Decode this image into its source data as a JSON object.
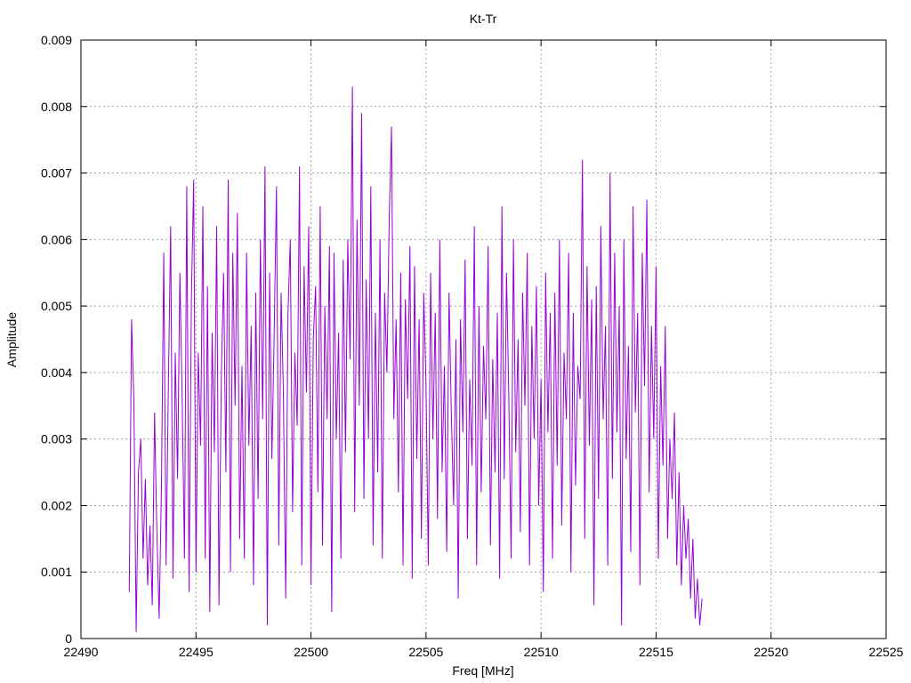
{
  "chart_data": {
    "type": "line",
    "title": "Kt-Tr",
    "xlabel": "Freq [MHz]",
    "ylabel": "Amplitude",
    "xlim": [
      22490,
      22525
    ],
    "ylim": [
      0,
      0.009
    ],
    "xticks": [
      "22490",
      "22495",
      "22500",
      "22505",
      "22510",
      "22515",
      "22520",
      "22525"
    ],
    "yticks": [
      "0",
      "0.001",
      "0.002",
      "0.003",
      "0.004",
      "0.005",
      "0.006",
      "0.007",
      "0.008",
      "0.009"
    ],
    "grid": true,
    "legend": "none",
    "series": [
      {
        "color": "#9400d3",
        "x_start": 22492.1,
        "x_step": 0.1,
        "values": [
          0.0007,
          0.0048,
          0.0036,
          0.0001,
          0.0025,
          0.003,
          0.0012,
          0.0024,
          0.0008,
          0.0017,
          0.0005,
          0.0034,
          0.0016,
          0.0003,
          0.0023,
          0.0058,
          0.0011,
          0.0038,
          0.0062,
          0.0009,
          0.0043,
          0.0024,
          0.0055,
          0.0036,
          0.0012,
          0.0068,
          0.0007,
          0.0051,
          0.0069,
          0.001,
          0.0043,
          0.0029,
          0.0065,
          0.0012,
          0.0053,
          0.0004,
          0.0046,
          0.0028,
          0.0062,
          0.0005,
          0.0039,
          0.0055,
          0.0025,
          0.0069,
          0.001,
          0.0058,
          0.0035,
          0.0064,
          0.0015,
          0.0041,
          0.0012,
          0.0058,
          0.0029,
          0.0047,
          0.0008,
          0.0052,
          0.0021,
          0.006,
          0.0033,
          0.0071,
          0.0002,
          0.0055,
          0.0027,
          0.0046,
          0.0068,
          0.0014,
          0.0052,
          0.0037,
          0.0006,
          0.0049,
          0.006,
          0.0019,
          0.0043,
          0.0032,
          0.0071,
          0.0011,
          0.0056,
          0.0037,
          0.0062,
          0.0008,
          0.0045,
          0.0053,
          0.0022,
          0.0065,
          0.0014,
          0.005,
          0.0033,
          0.0059,
          0.0004,
          0.0058,
          0.003,
          0.0046,
          0.0012,
          0.0057,
          0.0028,
          0.006,
          0.0042,
          0.0083,
          0.0019,
          0.0063,
          0.0035,
          0.0079,
          0.0021,
          0.0054,
          0.003,
          0.0068,
          0.0014,
          0.0049,
          0.0025,
          0.006,
          0.0012,
          0.0052,
          0.004,
          0.0063,
          0.0077,
          0.0033,
          0.0048,
          0.0022,
          0.0055,
          0.0011,
          0.0051,
          0.0036,
          0.0059,
          0.0009,
          0.0056,
          0.0027,
          0.0048,
          0.0015,
          0.0052,
          0.0038,
          0.0011,
          0.0055,
          0.003,
          0.0049,
          0.0018,
          0.006,
          0.0025,
          0.0041,
          0.0013,
          0.0052,
          0.0034,
          0.002,
          0.0045,
          0.0006,
          0.0048,
          0.0031,
          0.0057,
          0.0015,
          0.0039,
          0.0026,
          0.0062,
          0.0011,
          0.005,
          0.0022,
          0.0044,
          0.0033,
          0.0059,
          0.0014,
          0.0042,
          0.0025,
          0.0049,
          0.0009,
          0.0065,
          0.0024,
          0.0055,
          0.0036,
          0.0012,
          0.006,
          0.0028,
          0.0045,
          0.0016,
          0.0052,
          0.0035,
          0.0058,
          0.0011,
          0.0047,
          0.003,
          0.0053,
          0.002,
          0.0039,
          0.0007,
          0.0055,
          0.0031,
          0.0049,
          0.0012,
          0.0052,
          0.0026,
          0.006,
          0.0017,
          0.0043,
          0.0033,
          0.0058,
          0.001,
          0.0049,
          0.0023,
          0.0041,
          0.0036,
          0.0072,
          0.0015,
          0.0056,
          0.0029,
          0.0051,
          0.0005,
          0.0053,
          0.0021,
          0.0062,
          0.0033,
          0.0047,
          0.0011,
          0.007,
          0.0024,
          0.0058,
          0.0031,
          0.005,
          0.0002,
          0.006,
          0.0027,
          0.0044,
          0.0013,
          0.0065,
          0.0034,
          0.0049,
          0.0008,
          0.0058,
          0.0038,
          0.0066,
          0.0022,
          0.0047,
          0.003,
          0.0056,
          0.0012,
          0.0041,
          0.0026,
          0.0047,
          0.0015,
          0.003,
          0.0021,
          0.0034,
          0.0011,
          0.0025,
          0.0008,
          0.002,
          0.0012,
          0.0018,
          0.0006,
          0.0015,
          0.0003,
          0.0009,
          0.0002,
          0.0006
        ]
      }
    ]
  }
}
